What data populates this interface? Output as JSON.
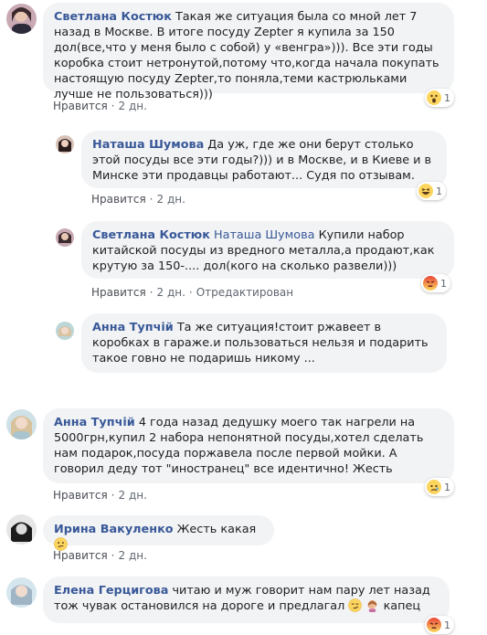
{
  "comments": [
    {
      "author": "Светлана Костюк",
      "text": "Такая же ситуация была со мной лет 7 назад в Москве. В итоге посуду Zepter я купила за 150 дол(все,что у меня было с собой) у «венгра»))). Все эти годы коробка стоит нетронутой,потому что,когда начала покупать настоящую посуду Zepter,то поняла,теми кастрюльками лучше не пользоваться)))",
      "like": "Нравится",
      "time": "2 дн.",
      "reaction": "wow",
      "reaction_count": "1"
    },
    {
      "author": "Наташа Шумова",
      "text": "Да уж, где же они берут столько этой посуды все эти годы?))) и в Москве, и в Киеве и в Минске эти продавцы работают... Судя по отзывам.",
      "like": "Нравится",
      "time": "2 дн.",
      "reaction": "haha",
      "reaction_count": "1"
    },
    {
      "author": "Светлана Костюк",
      "mention": "Наташа Шумова",
      "text": "Купили набор китайской посуды из вредного металла,а продают,как крутую за 150-.... дол(кого на сколько развели)))",
      "like": "Нравится",
      "time": "2 дн.",
      "edited": "Отредактирован",
      "reaction": "angry",
      "reaction_count": "1"
    },
    {
      "author": "Анна Тупчій",
      "text": "Та же ситуация!стоит ржавеет в коробках в гараже.и пользоваться нельзя и подарить такое говно не подаришь никому ...",
      "like": "Нравится",
      "time": "2 дн."
    },
    {
      "author": "Анна Тупчій",
      "text": "4 года назад дедушку моего так нагрели на 5000грн,купил 2 набора непонятной посуды,хотел сделать нам подарок,посуда поржавела после первой мойки. А говорил деду тот \"иностранец\" все идентично! Жесть",
      "like": "Нравится",
      "time": "2 дн.",
      "reaction": "sad",
      "reaction_count": "1"
    },
    {
      "author": "Ирина Вакуленко",
      "text": "Жесть какая",
      "like": "Нравится",
      "time": "2 дн."
    },
    {
      "author": "Елена Герцигова",
      "text_a": "читаю и муж говорит нам пару лет назад тож чувак остановился на дороге и предлагал",
      "text_b": "капец",
      "reaction": "angry",
      "reaction_count": "1"
    }
  ],
  "colors": {
    "author": "#385898",
    "bubble": "#f2f3f5",
    "meta": "#606770"
  }
}
